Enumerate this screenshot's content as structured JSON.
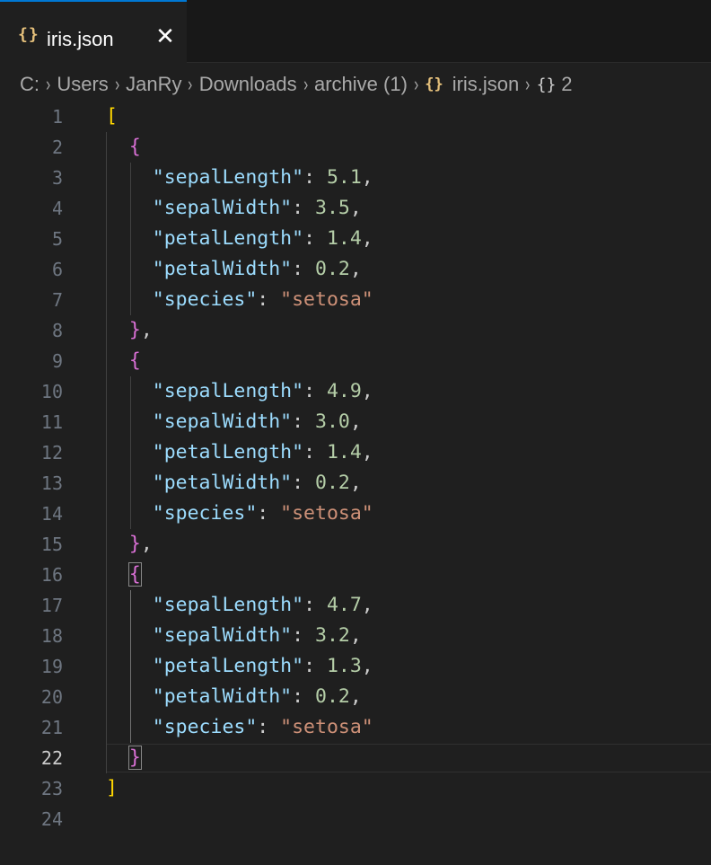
{
  "tab": {
    "icon": "{}",
    "label": "iris.json",
    "close_glyph": "✕"
  },
  "breadcrumb": {
    "drive": "C:",
    "users": "Users",
    "user": "JanRy",
    "downloads": "Downloads",
    "archive": "archive (1)",
    "file_icon": "{}",
    "file": "iris.json",
    "symbol_icon": "{}",
    "symbol": "2",
    "separator": "›"
  },
  "editor": {
    "active_line": "22",
    "line_numbers": [
      "1",
      "2",
      "3",
      "4",
      "5",
      "6",
      "7",
      "8",
      "9",
      "10",
      "11",
      "12",
      "13",
      "14",
      "15",
      "16",
      "17",
      "18",
      "19",
      "20",
      "21",
      "22",
      "23",
      "24"
    ],
    "records": [
      {
        "sepalLength": "5.1",
        "sepalWidth": "3.5",
        "petalLength": "1.4",
        "petalWidth": "0.2",
        "species": "setosa"
      },
      {
        "sepalLength": "4.9",
        "sepalWidth": "3.0",
        "petalLength": "1.4",
        "petalWidth": "0.2",
        "species": "setosa"
      },
      {
        "sepalLength": "4.7",
        "sepalWidth": "3.2",
        "petalLength": "1.3",
        "petalWidth": "0.2",
        "species": "setosa"
      }
    ],
    "keys": {
      "sepalLength": "\"sepalLength\"",
      "sepalWidth": "\"sepalWidth\"",
      "petalLength": "\"petalLength\"",
      "petalWidth": "\"petalWidth\"",
      "species": "\"species\""
    },
    "open_array": "[",
    "close_array": "]",
    "open_object": "{",
    "close_object": "}"
  },
  "colors": {
    "background": "#1f1f1f",
    "key": "#9cdcfe",
    "number": "#b5cea8",
    "string": "#ce9178",
    "bracket_level1": "#ffd700",
    "bracket_level2": "#da70d6",
    "tab_accent": "#0078d4",
    "json_icon": "#e5c07b"
  }
}
